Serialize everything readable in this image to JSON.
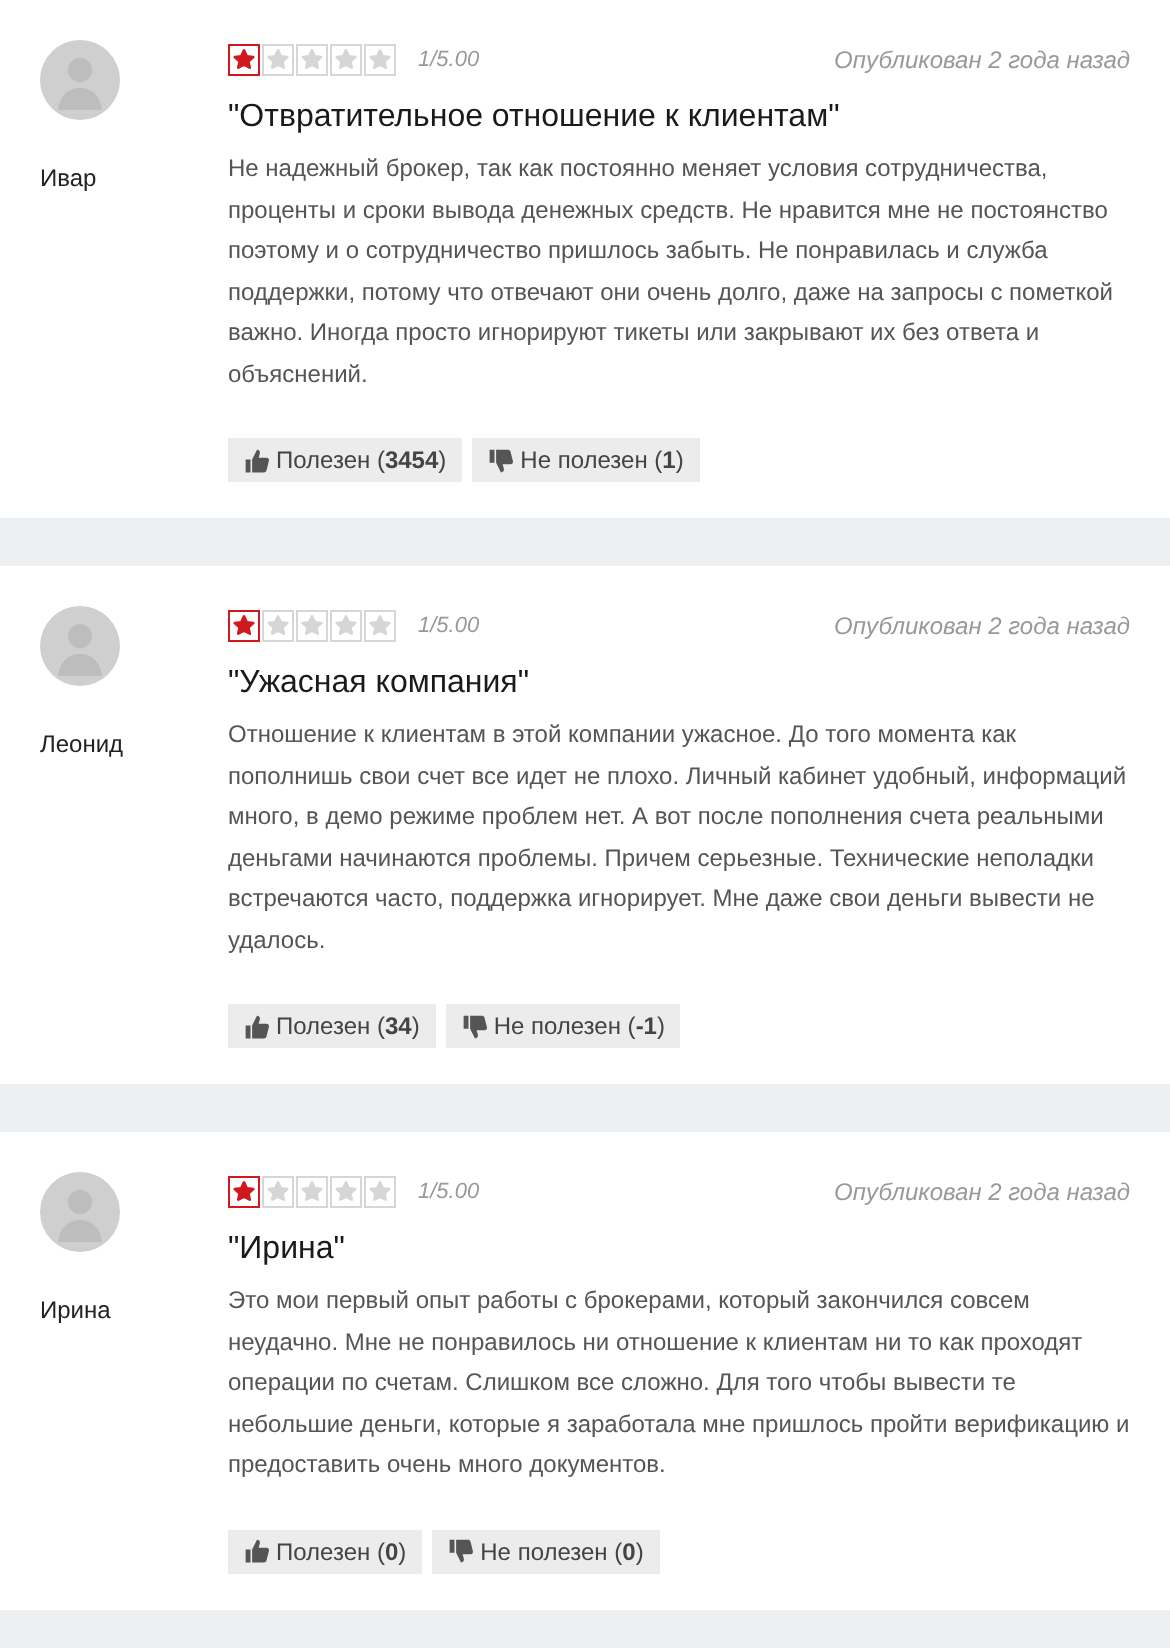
{
  "reviews": [
    {
      "author": "Ивар",
      "stars": 1,
      "rating": "1/5.00",
      "published": "Опубликован 2 года назад",
      "title": "\"Отвратительное отношение к клиентам\"",
      "text": "Не надежный брокер, так как постоянно меняет условия сотрудничества, проценты и сроки вывода денежных средств. Не нравится мне не постоянство поэтому и о сотрудничество пришлось забыть. Не понравилась и служба поддержки, потому что отвечают они очень долго, даже на запросы с пометкой важно. Иногда просто игнорируют тикеты или закрывают их без ответа и объяснений.",
      "helpful": "Полезен (**3454**)",
      "not_helpful": "Не полезен (**1**)"
    },
    {
      "author": "Леонид",
      "stars": 1,
      "rating": "1/5.00",
      "published": "Опубликован 2 года назад",
      "title": "\"Ужасная компания\"",
      "text": "Отношение к клиентам в этой компании ужасное. До того момента как пополнишь свои счет все идет не плохо. Личный кабинет удобный, информаций много, в демо режиме проблем нет. А вот после пополнения счета реальными деньгами начинаются проблемы. Причем серьезные. Технические неполадки встречаются часто, поддержка игнорирует. Мне даже свои деньги вывести не удалось.",
      "helpful": "Полезен (**34**)",
      "not_helpful": "Не полезен (**-1**)"
    },
    {
      "author": "Ирина",
      "stars": 1,
      "rating": "1/5.00",
      "published": "Опубликован 2 года назад",
      "title": "\"Ирина\"",
      "text": "Это мои первый опыт работы с брокерами, который закончился совсем неудачно. Мне не понравилось ни отношение к клиентам ни то как проходят операции по счетам. Слишком все сложно. Для того чтобы вывести те небольшие деньги, которые я заработала мне пришлось пройти верификацию и предоставить очень много документов.",
      "helpful": "Полезен (**0**)",
      "not_helpful": "Не полезен (**0**)"
    }
  ]
}
